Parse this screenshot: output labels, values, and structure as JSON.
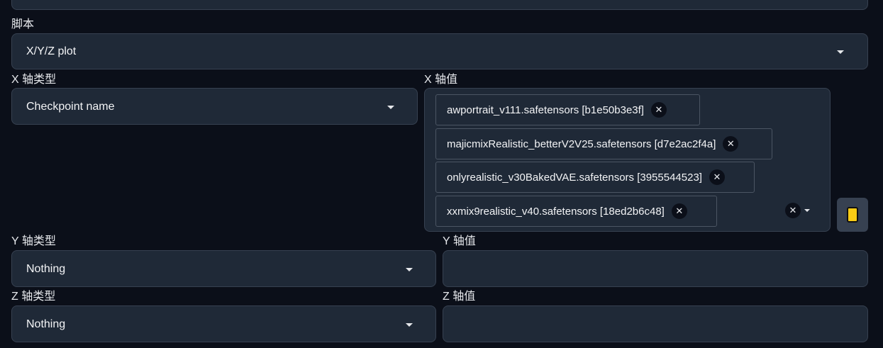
{
  "script": {
    "label": "脚本",
    "value": "X/Y/Z plot"
  },
  "x_axis": {
    "type_label": "X 轴类型",
    "type_value": "Checkpoint name",
    "values_label": "X 轴值",
    "values": [
      "awportrait_v111.safetensors [b1e50b3e3f]",
      "majicmixRealistic_betterV2V25.safetensors [d7e2ac2f4a]",
      "onlyrealistic_v30BakedVAE.safetensors [3955544523]",
      "xxmix9realistic_v40.safetensors [18ed2b6c48]"
    ]
  },
  "y_axis": {
    "type_label": "Y 轴类型",
    "type_value": "Nothing",
    "values_label": "Y 轴值",
    "values_text": ""
  },
  "z_axis": {
    "type_label": "Z 轴类型",
    "type_value": "Nothing",
    "values_label": "Z 轴值",
    "values_text": ""
  },
  "icons": {
    "remove": "close-icon",
    "dropdown": "chevron-down-icon",
    "tool": "card-file-icon"
  },
  "colors": {
    "background": "#0b0f19",
    "panel": "#1f2937",
    "border": "#374151",
    "accent": "#facc15"
  }
}
